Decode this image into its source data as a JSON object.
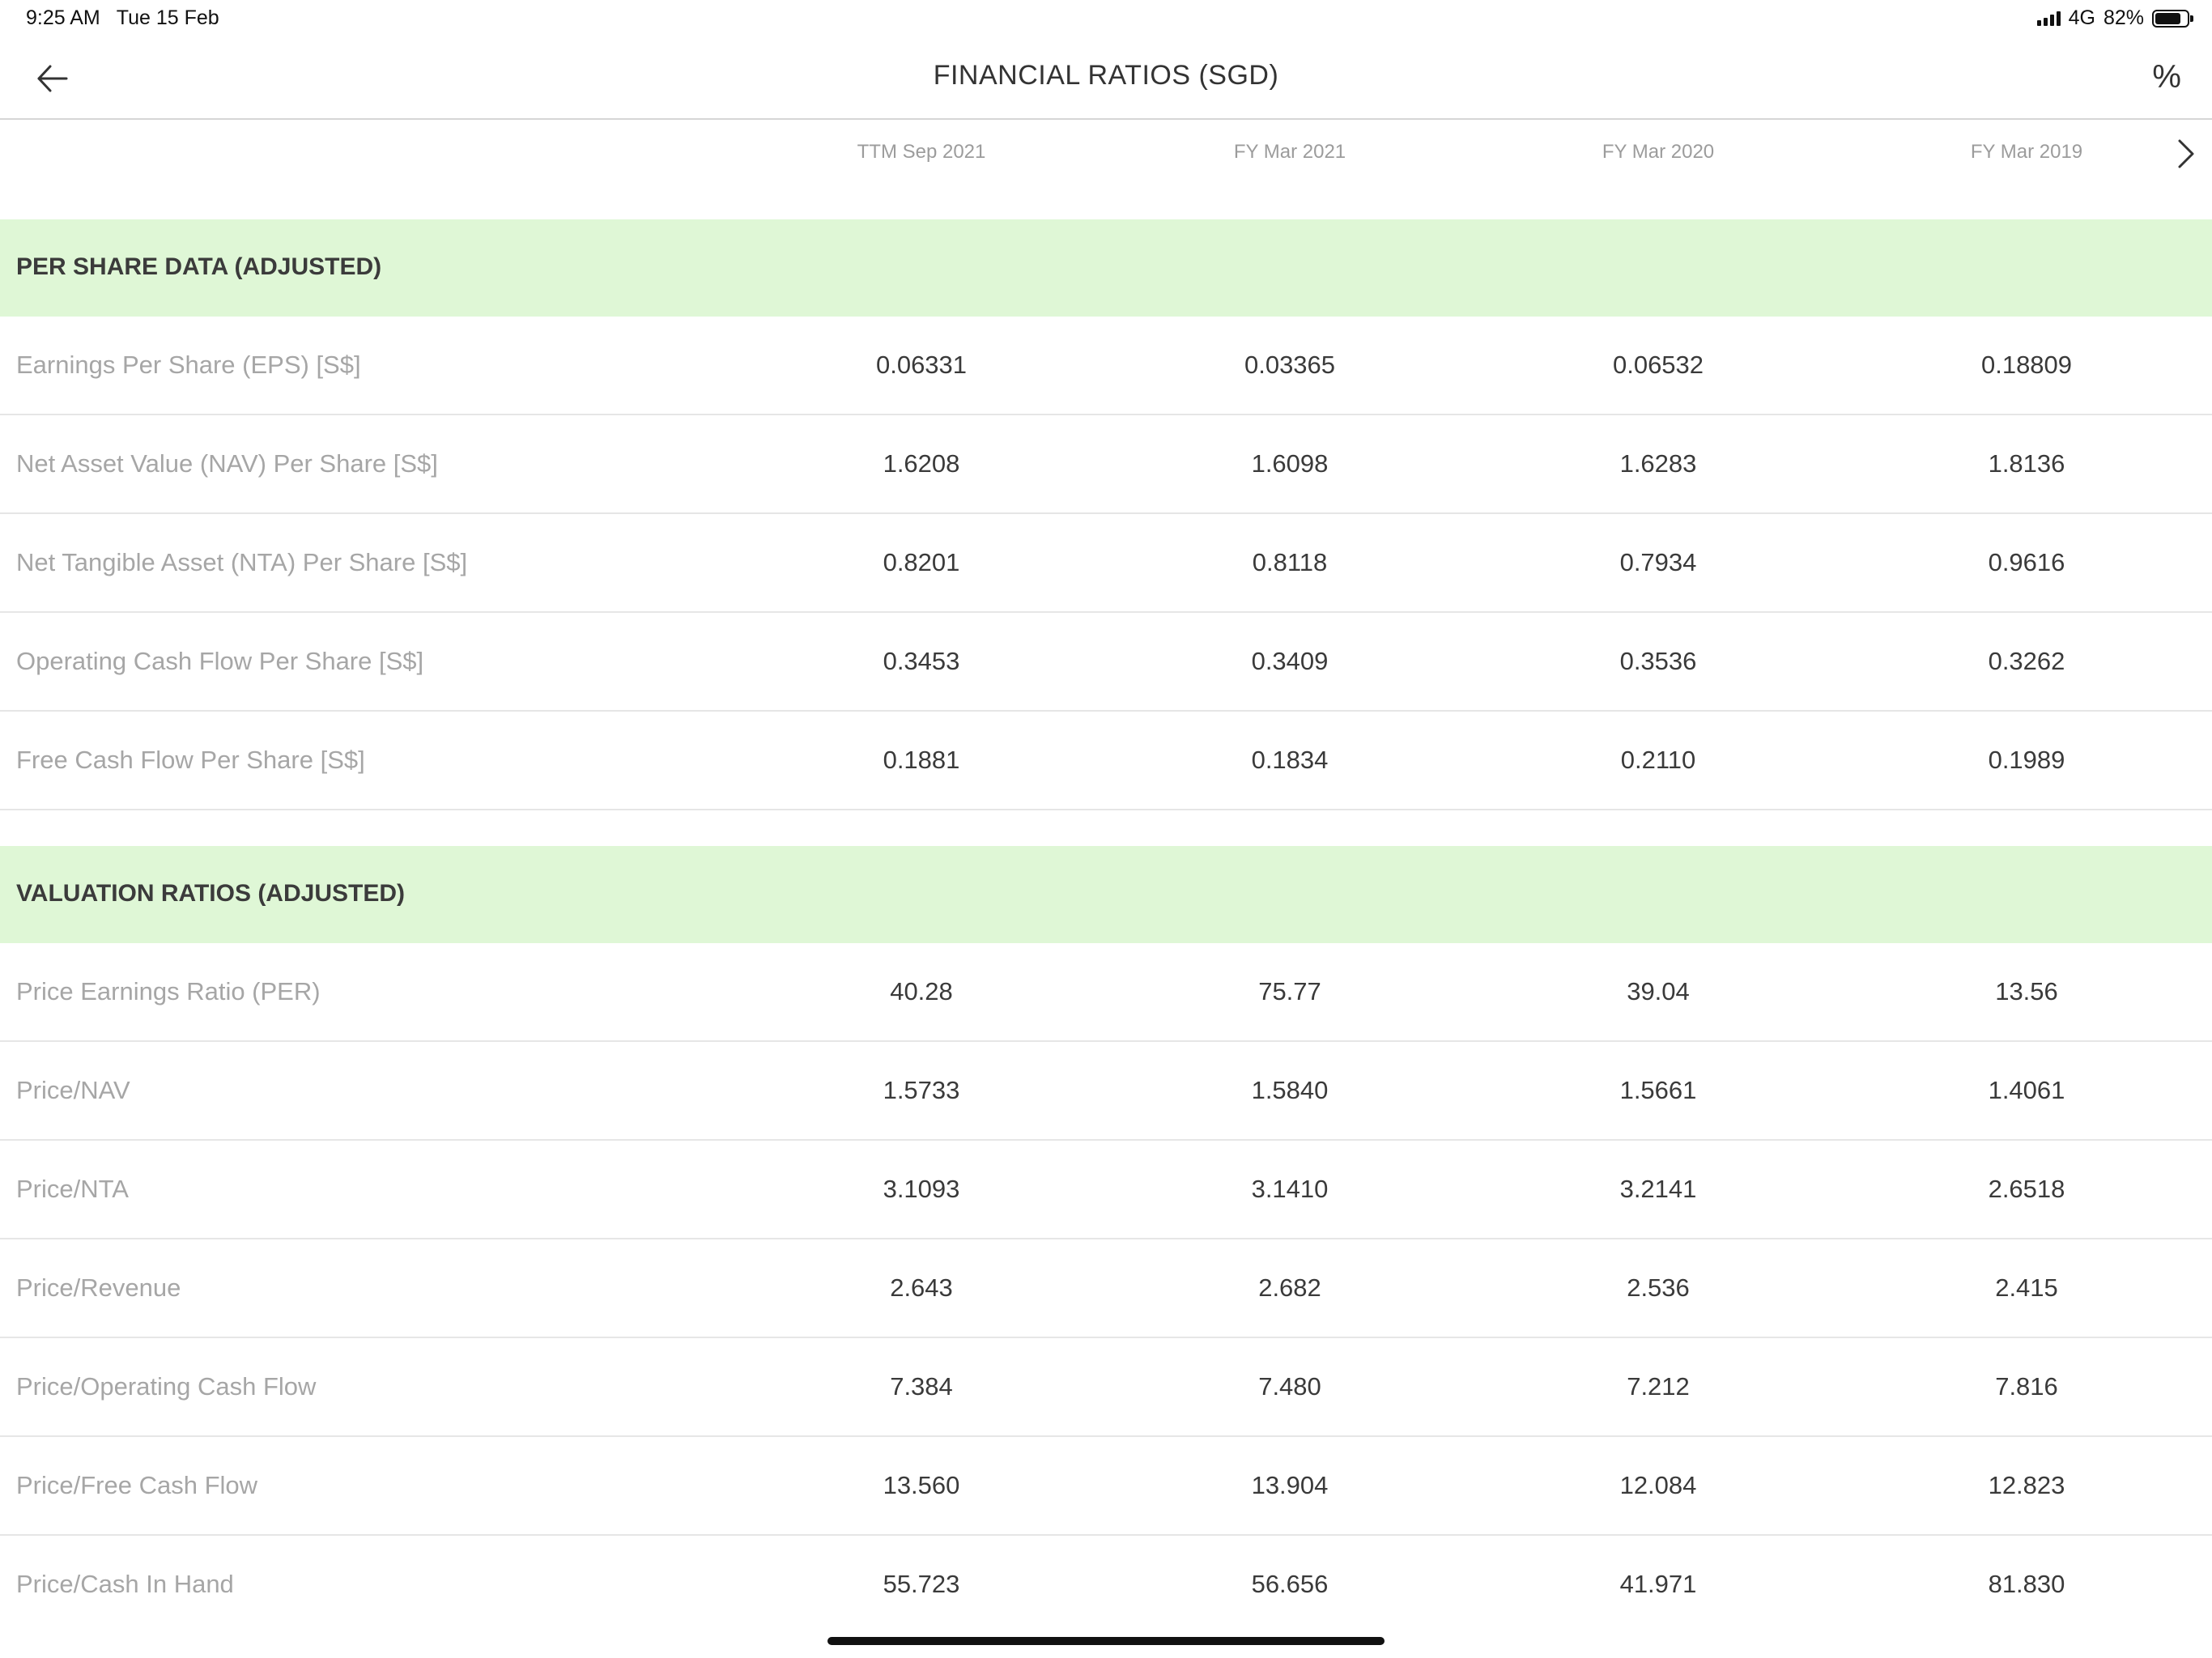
{
  "status_bar": {
    "time": "9:25 AM",
    "date": "Tue 15 Feb",
    "network": "4G",
    "battery": "82%",
    "battery_level": 0.82
  },
  "header": {
    "title": "FINANCIAL RATIOS (SGD)",
    "back_icon": "arrow-left-icon",
    "percent_label": "%"
  },
  "columns": [
    "TTM Sep 2021",
    "FY Mar 2021",
    "FY Mar 2020",
    "FY Mar 2019"
  ],
  "sections": [
    {
      "title": "PER SHARE DATA (ADJUSTED)",
      "rows": [
        {
          "label": "Earnings Per Share (EPS) [S$]",
          "values": [
            "0.06331",
            "0.03365",
            "0.06532",
            "0.18809"
          ]
        },
        {
          "label": "Net Asset Value (NAV) Per Share [S$]",
          "values": [
            "1.6208",
            "1.6098",
            "1.6283",
            "1.8136"
          ]
        },
        {
          "label": "Net Tangible Asset (NTA) Per Share [S$]",
          "values": [
            "0.8201",
            "0.8118",
            "0.7934",
            "0.9616"
          ]
        },
        {
          "label": "Operating Cash Flow Per Share [S$]",
          "values": [
            "0.3453",
            "0.3409",
            "0.3536",
            "0.3262"
          ]
        },
        {
          "label": "Free Cash Flow Per Share [S$]",
          "values": [
            "0.1881",
            "0.1834",
            "0.2110",
            "0.1989"
          ]
        }
      ]
    },
    {
      "title": "VALUATION RATIOS (ADJUSTED)",
      "rows": [
        {
          "label": "Price Earnings Ratio (PER)",
          "values": [
            "40.28",
            "75.77",
            "39.04",
            "13.56"
          ]
        },
        {
          "label": "Price/NAV",
          "values": [
            "1.5733",
            "1.5840",
            "1.5661",
            "1.4061"
          ]
        },
        {
          "label": "Price/NTA",
          "values": [
            "3.1093",
            "3.1410",
            "3.2141",
            "2.6518"
          ]
        },
        {
          "label": "Price/Revenue",
          "values": [
            "2.643",
            "2.682",
            "2.536",
            "2.415"
          ]
        },
        {
          "label": "Price/Operating Cash Flow",
          "values": [
            "7.384",
            "7.480",
            "7.212",
            "7.816"
          ]
        },
        {
          "label": "Price/Free Cash Flow",
          "values": [
            "13.560",
            "13.904",
            "12.084",
            "12.823"
          ]
        },
        {
          "label": "Price/Cash In Hand",
          "values": [
            "55.723",
            "56.656",
            "41.971",
            "81.830"
          ]
        }
      ]
    }
  ],
  "colors": {
    "section_background": "#dff7d6",
    "label_text": "#a6a6a6",
    "value_text": "#3a3a3a"
  }
}
